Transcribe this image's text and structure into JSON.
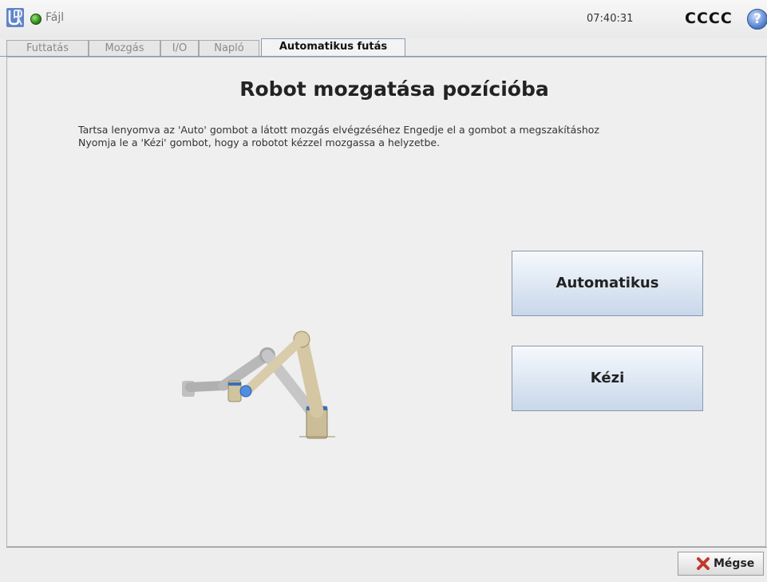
{
  "header": {
    "file_menu": "Fájl",
    "time": "07:40:31",
    "robot_name": "CCCC",
    "help_glyph": "?"
  },
  "tabs": [
    {
      "label": "Futtatás",
      "active": false
    },
    {
      "label": "Mozgás",
      "active": false
    },
    {
      "label": "I/O",
      "active": false
    },
    {
      "label": "Napló",
      "active": false
    },
    {
      "label": "Automatikus futás",
      "active": true
    }
  ],
  "main": {
    "title": "Robot mozgatása pozícióba",
    "instruction_line1": "Tartsa lenyomva az 'Auto' gombot a látott mozgás elvégzéséhez Engedje el a gombot a megszakításhoz",
    "instruction_line2": "Nyomja le a 'Kézi' gombot, hogy a robotot kézzel mozgassa a helyzetbe.",
    "auto_button": "Automatikus",
    "manual_button": "Kézi"
  },
  "footer": {
    "cancel_button": "Mégse"
  },
  "icons": {
    "logo": "ur-logo-icon",
    "status": "status-ok-icon",
    "help": "help-icon",
    "cancel": "cancel-x-icon"
  },
  "colors": {
    "status_green": "#2f8a1c",
    "button_blue": "#c8d7ea",
    "cancel_red": "#c0392b"
  }
}
